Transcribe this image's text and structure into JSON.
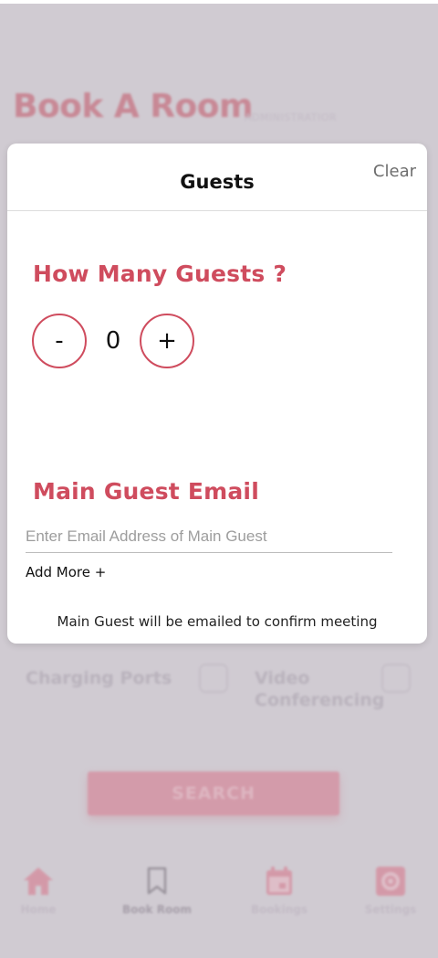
{
  "background": {
    "title": "Book A Room",
    "subtitle": "ADMINISTRATIOR",
    "amenities": [
      {
        "label": "Charging Ports"
      },
      {
        "label": "Video Conferencing"
      }
    ],
    "search_label": "SEARCH",
    "nav": [
      {
        "label": "Home",
        "icon": "home-icon"
      },
      {
        "label": "Book Room",
        "icon": "bookmark-icon"
      },
      {
        "label": "Bookings",
        "icon": "calendar-icon"
      },
      {
        "label": "Settings",
        "icon": "gear-icon"
      }
    ]
  },
  "modal": {
    "title": "Guests",
    "clear_label": "Clear",
    "guests_heading": "How Many Guests ?",
    "decrement_label": "-",
    "guest_count": "0",
    "increment_label": "+",
    "email_heading": "Main Guest Email",
    "email_placeholder": "Enter Email Address of Main Guest",
    "email_value": "",
    "add_more_label": "Add More +",
    "footnote": "Main Guest will be emailed to confirm meeting"
  },
  "colors": {
    "accent": "#cf4c5e",
    "backdrop": "#d0cbd2"
  }
}
